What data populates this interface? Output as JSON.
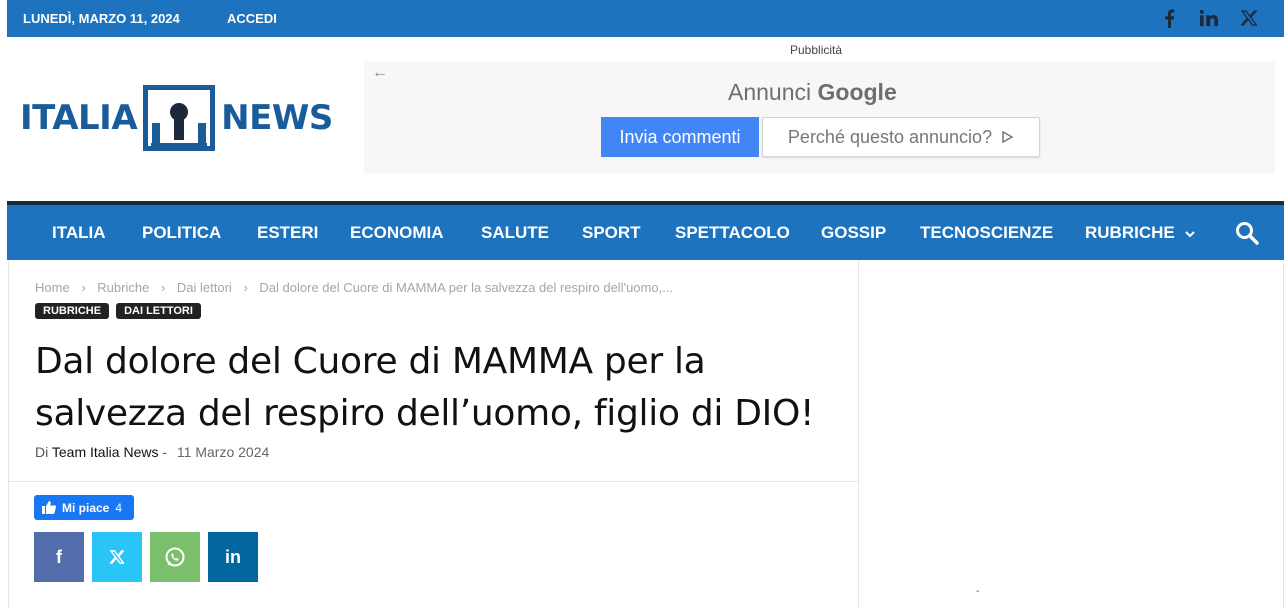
{
  "topbar": {
    "date": "LUNEDÌ, MARZO 11, 2024",
    "login": "ACCEDI",
    "social": [
      "facebook-icon",
      "linkedin-icon",
      "x-icon"
    ]
  },
  "logo": {
    "left": "ITALIA",
    "right": "NEWS"
  },
  "ad": {
    "label": "Pubblicità",
    "title_prefix": "Annunci",
    "title_brand": "Google",
    "feedback_button": "Invia commenti",
    "why_button": "Perché questo annuncio?"
  },
  "nav": {
    "items": [
      {
        "label": "ITALIA"
      },
      {
        "label": "POLITICA"
      },
      {
        "label": "ESTERI"
      },
      {
        "label": "ECONOMIA"
      },
      {
        "label": "SALUTE"
      },
      {
        "label": "SPORT"
      },
      {
        "label": "SPETTACOLO"
      },
      {
        "label": "GOSSIP"
      },
      {
        "label": "TECNOSCIENZE"
      },
      {
        "label": "RUBRICHE"
      }
    ],
    "search_icon": "search-icon"
  },
  "breadcrumb": {
    "home": "Home",
    "section": "Rubriche",
    "subsection": "Dai lettori",
    "current": "Dal dolore del Cuore di MAMMA per la salvezza del respiro dell'uomo,..."
  },
  "categories": [
    "RUBRICHE",
    "DAI LETTORI"
  ],
  "article": {
    "title": "Dal dolore del Cuore di MAMMA per la salvezza del respiro dell’uomo, figlio di DIO!",
    "by": "Di",
    "author": "Team Italia News",
    "dash": "-",
    "date": "11 Marzo 2024"
  },
  "like": {
    "label": "Mi piace",
    "count": "4"
  },
  "share": {
    "facebook": "f",
    "twitter": "𝕏",
    "whatsapp": "whatsapp-icon",
    "linkedin": "in"
  },
  "colors": {
    "brand_blue": "#1e73be",
    "dark": "#1b2a3a",
    "facebook": "#516eab",
    "twitter": "#29c5f6",
    "whatsapp": "#7bbf6a",
    "linkedin": "#0266a0",
    "fb_like": "#1877f2"
  }
}
